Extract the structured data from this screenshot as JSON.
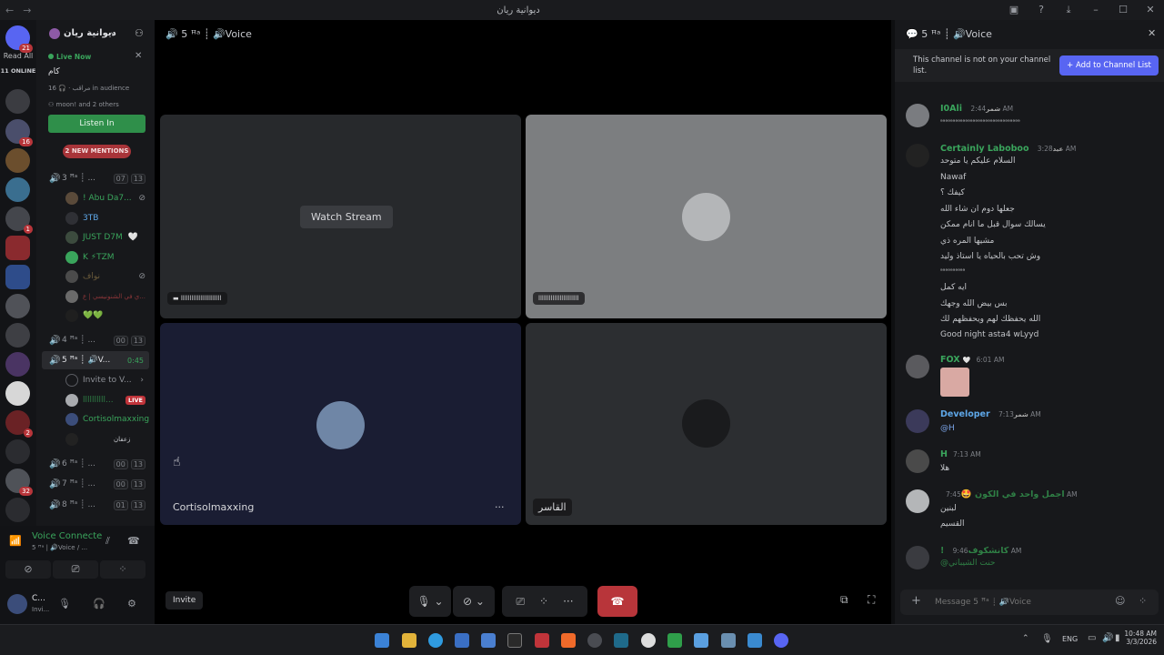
{
  "window": {
    "title": "ديوانية ريان",
    "nav_back": "←",
    "nav_fwd": "→"
  },
  "rail": {
    "read_all": "Read All",
    "online": "11 ONLINE",
    "badges": [
      "21",
      "16",
      "1",
      "2",
      "32"
    ]
  },
  "sidebar": {
    "server_name": "ديوانية ريان",
    "live_now": "Live Now",
    "live_stage": "كام",
    "audience": "16 in audience",
    "audience_prefix": "مراقب ·",
    "others": "moon! and 2 others",
    "listen_in": "Listen In",
    "mentions": "2 NEW MENTIONS",
    "channels": [
      {
        "name": "3 ꟸᵃ ┊ ...",
        "users": "07",
        "limit": "13"
      },
      {
        "name": "4 ꟸᵃ ┊ ...",
        "users": "00",
        "limit": "13"
      },
      {
        "name": "5 ꟸᵃ ┊ 🔊V...",
        "time": "0:45"
      },
      {
        "name": "6 ꟸᵃ ┊ ...",
        "users": "00",
        "limit": "13"
      },
      {
        "name": "7 ꟸᵃ ┊ ...",
        "users": "00",
        "limit": "13"
      },
      {
        "name": "8 ꟸᵃ ┊ ...",
        "users": "01",
        "limit": "13"
      }
    ],
    "members_ch3": [
      "! Abu Da7...",
      "3TB",
      "JUST D7M",
      "K ⚡TZM",
      "نواف",
      "ي في الشنونيسي | ع...",
      "💚💚"
    ],
    "members_ch5": [
      "Invite to V...",
      "llllllllll...",
      "Cortisolmaxxing",
      "زعفان"
    ],
    "live_badge": "LIVE"
  },
  "userpanel": {
    "voice_connected": "Voice Connecte",
    "voice_sub": "5 ꟸᵃ | 🔊Voice / ...",
    "username": "C...",
    "status": "Invi..."
  },
  "stage": {
    "channel_title": "5 ꟸᵃ ┊ 🔊Voice",
    "watch_stream": "Watch Stream",
    "tile1_name": "lllllllllllllllllllllll",
    "tile2_name": "lllllllllllllllllllllll",
    "tile3_name": "Cortisolmaxxing",
    "tile4_name": "القاسر",
    "more": "···",
    "invite": "Invite"
  },
  "chat": {
    "header": "5 ꟸᵃ ┊ 🔊Voice",
    "notice": "This channel is not on your channel list.",
    "add_button": "+ Add to Channel List",
    "placeholder": "Message 5 ꟸᵃ ┊ 🔊Voice",
    "messages": [
      {
        "name": "I0Ali",
        "tag": "شمر",
        "time": "2:44 AM",
        "color": "#3aa55c",
        "lines": [
          "ᵃᵃᵃᵃᵃᵃᵃᵃᵃᵃᵃᵃᵃᵃᵃᵃᵃᵃᵃᵃᵃᵃᵃᵃᵃᵃᵃᵃᵃᵃᵃᵃ"
        ]
      },
      {
        "name": "Certainly Laboboo",
        "tag": "عيد",
        "time": "3:28 AM",
        "color": "#3aa55c",
        "lines": [
          "السلام عليكم يا متوحد",
          "Nawaf",
          "كيفك ؟",
          "جعلها دوم ان شاء الله",
          "يسالك سوال قبل ما انام ممكن",
          "مشيها المره ذي",
          "وش تحب بالحياه يا استاذ وليد",
          "ᵃᵃᵃᵃᵃᵃᵃᵃᵃᵃ",
          "ايه كمل",
          "بس بيض الله وجهك",
          "الله يحفظك لهم ويحفظهم لك",
          "Good night asta4 wLyyd"
        ]
      },
      {
        "name": "FOX",
        "tag": "🤍",
        "time": "6:01 AM",
        "color": "#3aa55c",
        "lines": []
      },
      {
        "name": "Developer",
        "tag": "شمر",
        "time": "7:13 AM",
        "color": "#5ea7e8",
        "lines": [
          "@H"
        ]
      },
      {
        "name": "H",
        "tag": "",
        "time": "7:13 AM",
        "color": "#3aa55c",
        "lines": [
          "هلا"
        ]
      },
      {
        "name": "اجمل واحد في الكون 🤩",
        "tag": "",
        "time": "7:45 AM",
        "color": "#3aa55c",
        "lines": [
          "لبنين",
          "القسيم"
        ]
      },
      {
        "name": "! كانشكوف",
        "tag": "",
        "time": "9:46 AM",
        "color": "#3aa55c",
        "lines": [
          "@حنت الشيباني"
        ]
      }
    ]
  },
  "taskbar": {
    "lang": "ENG",
    "time": "10:48 AM",
    "date": "3/3/2026"
  }
}
